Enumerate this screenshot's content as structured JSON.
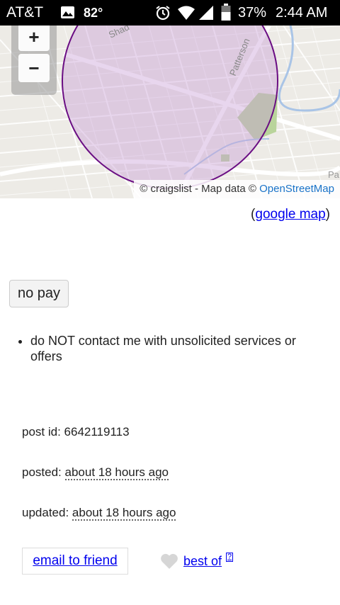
{
  "status_bar": {
    "carrier": "AT&T",
    "temperature": "82°",
    "battery": "37%",
    "time": "2:44 AM"
  },
  "map": {
    "zoom_in": "+",
    "zoom_out": "−",
    "attribution_prefix": "© craigslist - Map data ©",
    "attribution_link": "OpenStreetMap",
    "street_labels": [
      "Patterson",
      "Shad",
      "Pa"
    ],
    "circle_color": "#6a0d83"
  },
  "google_map": {
    "open": "(",
    "link": "google map",
    "close": ")"
  },
  "compensation": "no pay",
  "notices": [
    "do NOT contact me with unsolicited services or offers"
  ],
  "meta": {
    "post_id_label": "post id:",
    "post_id": "6642119113",
    "posted_label": "posted:",
    "posted": "about 18 hours ago",
    "updated_label": "updated:",
    "updated": "about 18 hours ago"
  },
  "actions": {
    "email_to_friend": "email to friend",
    "best_of": "best of",
    "help": "?"
  }
}
